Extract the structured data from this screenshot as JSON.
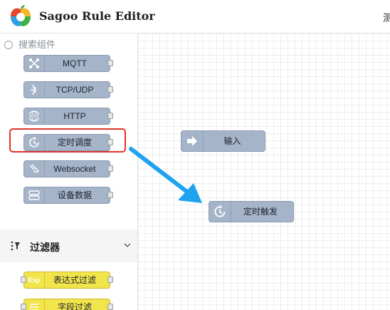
{
  "header": {
    "title": "Sagoo Rule Editor",
    "right_text": "测"
  },
  "sidebar": {
    "search_placeholder": "搜索组件",
    "nodes": [
      {
        "label": "MQTT",
        "icon": "mqtt-icon"
      },
      {
        "label": "TCP/UDP",
        "icon": "signal-icon"
      },
      {
        "label": "HTTP",
        "icon": "http-globe-icon"
      },
      {
        "label": "定时调度",
        "icon": "timer-icon"
      },
      {
        "label": "Websocket",
        "icon": "websocket-icon"
      },
      {
        "label": "设备数据",
        "icon": "device-icon"
      }
    ],
    "section": {
      "label": "过滤器",
      "icon": "filter-icon"
    },
    "filter_nodes": [
      {
        "label": "表达式过滤",
        "icon_text": "Exp"
      },
      {
        "label": "字段过滤",
        "icon": "list-icon"
      }
    ]
  },
  "canvas": {
    "nodes": [
      {
        "label": "输入",
        "icon": "input-arrow-icon"
      },
      {
        "label": "定时触发",
        "icon": "timer-icon"
      }
    ]
  },
  "colors": {
    "node": "#a5b4c9",
    "highlight": "#e0352b",
    "arrow": "#1fa3f0",
    "filter_node": "#f2e44b"
  }
}
